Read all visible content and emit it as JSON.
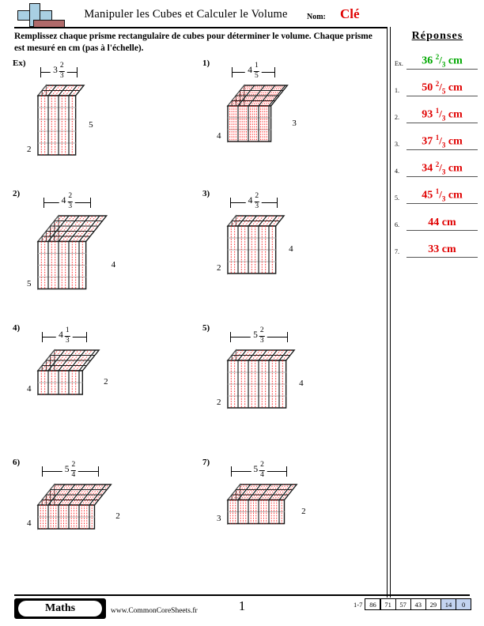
{
  "header": {
    "title": "Manipuler les Cubes et Calculer le Volume",
    "name_label": "Nom:",
    "name_value": "Clé",
    "logo_icon": "plus-block-logo"
  },
  "instructions": "Remplissez chaque prisme rectangulaire de cubes pour déterminer le volume. Chaque prisme est mesuré en cm (pas à l'échelle).",
  "answers": {
    "title": "Réponses",
    "example_color": "#00a800",
    "answer_color": "#e00000",
    "rows": [
      {
        "num": "Ex.",
        "whole": "36",
        "numerator": "2",
        "denominator": "3",
        "unit": "cm",
        "is_example": true
      },
      {
        "num": "1.",
        "whole": "50",
        "numerator": "2",
        "denominator": "5",
        "unit": "cm",
        "is_example": false
      },
      {
        "num": "2.",
        "whole": "93",
        "numerator": "1",
        "denominator": "3",
        "unit": "cm",
        "is_example": false
      },
      {
        "num": "3.",
        "whole": "37",
        "numerator": "1",
        "denominator": "3",
        "unit": "cm",
        "is_example": false
      },
      {
        "num": "4.",
        "whole": "34",
        "numerator": "2",
        "denominator": "3",
        "unit": "cm",
        "is_example": false
      },
      {
        "num": "5.",
        "whole": "45",
        "numerator": "1",
        "denominator": "3",
        "unit": "cm",
        "is_example": false
      },
      {
        "num": "6.",
        "whole": "44",
        "numerator": "",
        "denominator": "",
        "unit": "cm",
        "is_example": false
      },
      {
        "num": "7.",
        "whole": "33",
        "numerator": "",
        "denominator": "",
        "unit": "cm",
        "is_example": false
      }
    ]
  },
  "problems": [
    {
      "label": "Ex)",
      "width_whole": "3",
      "width_num": "2",
      "width_den": "3",
      "height": "5",
      "depth": "2",
      "w_units": 3,
      "w_frac_parts": 2,
      "w_frac_den": 3,
      "h_units": 5,
      "d_units": 2
    },
    {
      "label": "1)",
      "width_whole": "4",
      "width_num": "1",
      "width_den": "5",
      "height": "3",
      "depth": "4",
      "w_units": 4,
      "w_frac_parts": 1,
      "w_frac_den": 5,
      "h_units": 3,
      "d_units": 4
    },
    {
      "label": "2)",
      "width_whole": "4",
      "width_num": "2",
      "width_den": "3",
      "height": "4",
      "depth": "5",
      "w_units": 4,
      "w_frac_parts": 2,
      "w_frac_den": 3,
      "h_units": 4,
      "d_units": 5
    },
    {
      "label": "3)",
      "width_whole": "4",
      "width_num": "2",
      "width_den": "3",
      "height": "4",
      "depth": "2",
      "w_units": 4,
      "w_frac_parts": 2,
      "w_frac_den": 3,
      "h_units": 4,
      "d_units": 2
    },
    {
      "label": "4)",
      "width_whole": "4",
      "width_num": "1",
      "width_den": "3",
      "height": "2",
      "depth": "4",
      "w_units": 4,
      "w_frac_parts": 1,
      "w_frac_den": 3,
      "h_units": 2,
      "d_units": 4
    },
    {
      "label": "5)",
      "width_whole": "5",
      "width_num": "2",
      "width_den": "3",
      "height": "4",
      "depth": "2",
      "w_units": 5,
      "w_frac_parts": 2,
      "w_frac_den": 3,
      "h_units": 4,
      "d_units": 2
    },
    {
      "label": "6)",
      "width_whole": "5",
      "width_num": "2",
      "width_den": "4",
      "height": "2",
      "depth": "4",
      "w_units": 5,
      "w_frac_parts": 2,
      "w_frac_den": 4,
      "h_units": 2,
      "d_units": 4
    },
    {
      "label": "7)",
      "width_whole": "5",
      "width_num": "2",
      "width_den": "4",
      "height": "2",
      "depth": "3",
      "w_units": 5,
      "w_frac_parts": 2,
      "w_frac_den": 4,
      "h_units": 2,
      "d_units": 3
    }
  ],
  "footer": {
    "brand": "Maths",
    "site": "www.CommonCoreSheets.fr",
    "page_number": "1",
    "score_range": "1-7",
    "score_values": [
      "86",
      "71",
      "57",
      "43",
      "29",
      "14",
      "0"
    ],
    "score_highlight_from_index": 5,
    "highlight_color": "#c3d3f0"
  }
}
